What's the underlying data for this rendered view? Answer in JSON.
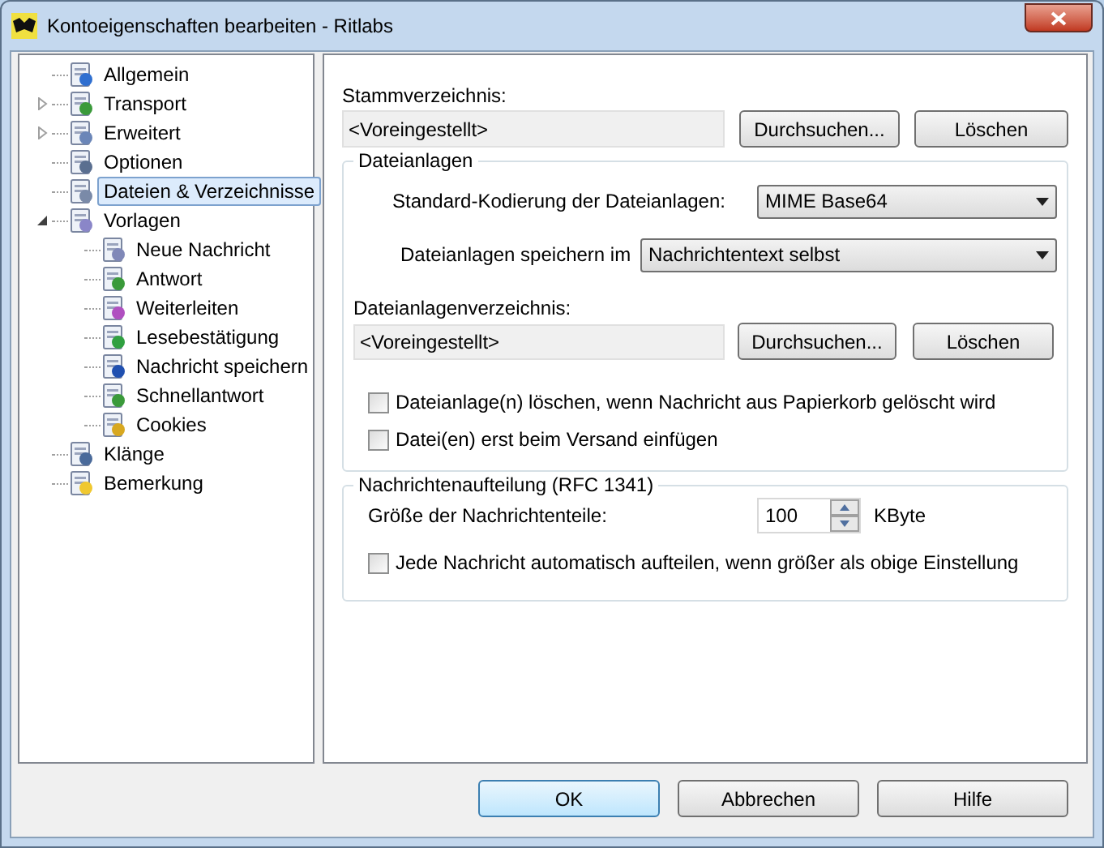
{
  "window": {
    "title": "Kontoeigenschaften bearbeiten - Ritlabs"
  },
  "tree": [
    {
      "label": "Allgemein",
      "selected": false
    },
    {
      "label": "Transport",
      "selected": false,
      "expanded": false
    },
    {
      "label": "Erweitert",
      "selected": false,
      "expanded": false
    },
    {
      "label": "Optionen",
      "selected": false
    },
    {
      "label": "Dateien & Verzeichnisse",
      "selected": true
    },
    {
      "label": "Vorlagen",
      "selected": false,
      "expanded": true,
      "children": [
        {
          "label": "Neue Nachricht",
          "selected": false
        },
        {
          "label": "Antwort",
          "selected": false
        },
        {
          "label": "Weiterleiten",
          "selected": false
        },
        {
          "label": "Lesebestätigung",
          "selected": false
        },
        {
          "label": "Nachricht speichern",
          "selected": false
        },
        {
          "label": "Schnellantwort",
          "selected": false
        },
        {
          "label": "Cookies",
          "selected": false
        }
      ]
    },
    {
      "label": "Klänge",
      "selected": false
    },
    {
      "label": "Bemerkung",
      "selected": false
    }
  ],
  "root_dir": {
    "label": "Stammverzeichnis:",
    "value": "<Voreingestellt>",
    "buttons": [
      "Durchsuchen...",
      "Löschen"
    ]
  },
  "attachments": {
    "title": "Dateianlagen",
    "encoding": {
      "label": "Standard-Kodierung der Dateianlagen:",
      "value": "MIME Base64"
    },
    "storage": {
      "label": "Dateianlagen speichern im",
      "value": "Nachrichtentext selbst"
    },
    "dir": {
      "label": "Dateianlagenverzeichnis:",
      "value": "<Voreingestellt>",
      "buttons": [
        "Durchsuchen...",
        "Löschen"
      ]
    },
    "checkboxes": [
      {
        "label": "Dateianlage(n) löschen, wenn Nachricht aus Papierkorb gelöscht wird",
        "checked": false
      },
      {
        "label": "Datei(en) erst beim Versand einfügen",
        "checked": false
      }
    ]
  },
  "splitting": {
    "title": "Nachrichtenaufteilung (RFC 1341)",
    "size": {
      "label": "Größe der Nachrichtenteile:",
      "value": "100",
      "unit": "KByte"
    },
    "checkboxes": [
      {
        "label": "Jede Nachricht automatisch aufteilen, wenn größer als obige Einstellung",
        "checked": false
      }
    ]
  },
  "buttons": [
    {
      "label": "OK",
      "default": true
    },
    {
      "label": "Abbrechen",
      "default": false
    },
    {
      "label": "Hilfe",
      "default": false
    }
  ]
}
